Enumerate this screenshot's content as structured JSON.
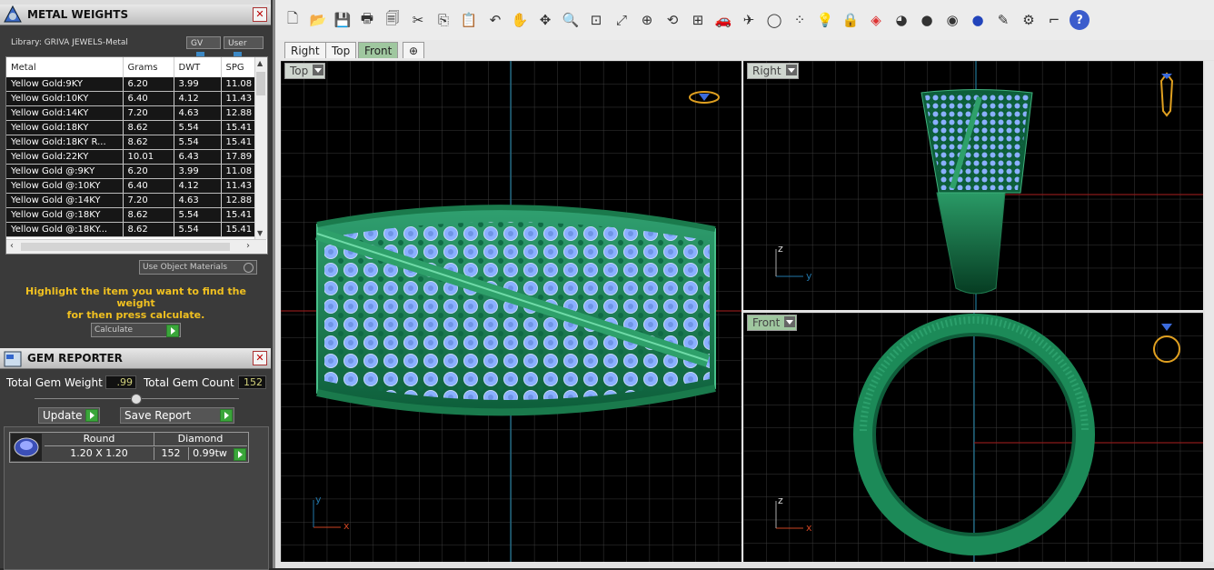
{
  "metal_panel": {
    "title": "METAL WEIGHTS",
    "library": "Library: GRIVA JEWELS-Metal",
    "gv_label": "GV",
    "user_label": "User",
    "columns": [
      "Metal",
      "Grams",
      "DWT",
      "SPG"
    ],
    "rows": [
      [
        "Yellow Gold:9KY",
        "6.20",
        "3.99",
        "11.08"
      ],
      [
        "Yellow Gold:10KY",
        "6.40",
        "4.12",
        "11.43"
      ],
      [
        "Yellow Gold:14KY",
        "7.20",
        "4.63",
        "12.88"
      ],
      [
        "Yellow Gold:18KY",
        "8.62",
        "5.54",
        "15.41"
      ],
      [
        "Yellow Gold:18KY R...",
        "8.62",
        "5.54",
        "15.41"
      ],
      [
        "Yellow Gold:22KY",
        "10.01",
        "6.43",
        "17.89"
      ],
      [
        "Yellow Gold @:9KY",
        "6.20",
        "3.99",
        "11.08"
      ],
      [
        "Yellow Gold @:10KY",
        "6.40",
        "4.12",
        "11.43"
      ],
      [
        "Yellow Gold @:14KY",
        "7.20",
        "4.63",
        "12.88"
      ],
      [
        "Yellow Gold @:18KY",
        "8.62",
        "5.54",
        "15.41"
      ],
      [
        "Yellow Gold @:18KY...",
        "8.62",
        "5.54",
        "15.41"
      ]
    ],
    "use_object_materials": "Use Object Materials",
    "highlight_text_1": "Highlight the item you want to find the weight",
    "highlight_text_2": "for then press calculate.",
    "calculate_label": "Calculate"
  },
  "gem_panel": {
    "title": "GEM REPORTER",
    "total_weight_label": "Total Gem Weight",
    "total_weight_value": ".99",
    "total_count_label": "Total Gem Count",
    "total_count_value": "152",
    "update_label": "Update",
    "save_report_label": "Save Report",
    "shape_header": "Round",
    "material_header": "Diamond",
    "size": "1.20 X 1.20",
    "count": "152",
    "weight": "0.99tw"
  },
  "tabs": [
    "Right",
    "Top",
    "Front"
  ],
  "active_tab": "Front",
  "viewports": {
    "top": {
      "label": "Top",
      "axis1": "y",
      "axis2": "x"
    },
    "right": {
      "label": "Right",
      "axis1": "z",
      "axis2": "y"
    },
    "front": {
      "label": "Front",
      "axis1": "z",
      "axis2": "x"
    }
  },
  "colors": {
    "ring": "#1f8a5a",
    "gem": "#8ab0ff",
    "grid": "#3a3a3a",
    "accent": "#f0c020"
  },
  "toolbar_icons": [
    "new-icon",
    "open-icon",
    "save-icon",
    "print-icon",
    "properties-icon",
    "cut-icon",
    "copy-icon",
    "paste-icon",
    "undo-icon",
    "pan-icon",
    "rotate-icon",
    "zoom-icon",
    "zoom-window-icon",
    "zoom-extents-icon",
    "zoom-selected-icon",
    "rotate-view-icon",
    "four-view-icon",
    "car-icon",
    "plane-icon",
    "circle-icon",
    "points-icon",
    "bulb-icon",
    "lock-icon",
    "layer-icon",
    "color-wheel-icon",
    "sphere-grey-icon",
    "sphere-shaded-icon",
    "sphere-blue-icon",
    "pencil-icon",
    "gear-icon",
    "dimension-icon",
    "help-icon"
  ]
}
